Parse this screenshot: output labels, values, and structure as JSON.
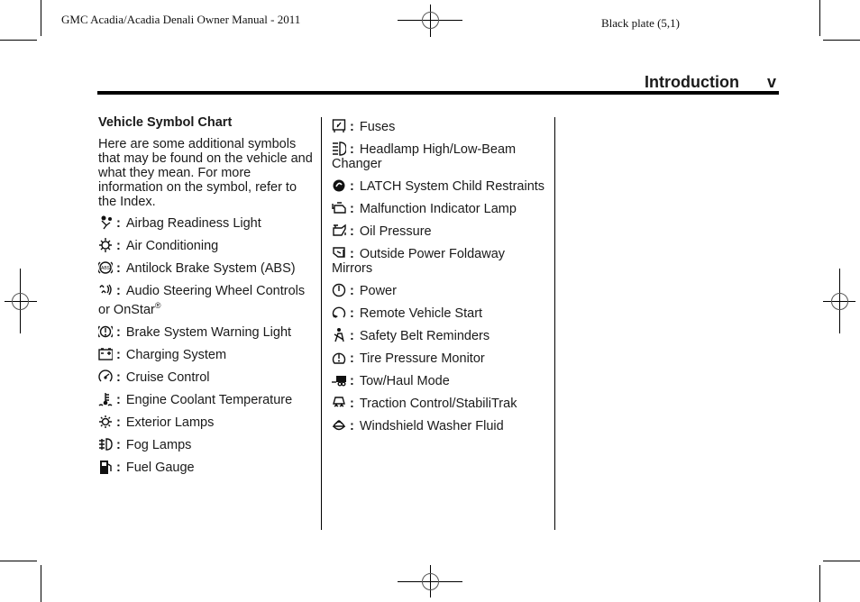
{
  "print_header": {
    "manual_title": "GMC Acadia/Acadia Denali Owner Manual - 2011",
    "plate": "Black plate (5,1)"
  },
  "running_head": {
    "section": "Introduction",
    "page_number": "v"
  },
  "section_title": "Vehicle Symbol Chart",
  "intro_text": "Here are some additional symbols that may be found on the vehicle and what they mean. For more information on the symbol, refer to the Index.",
  "separator": ":",
  "column1": [
    {
      "icon": "airbag-icon",
      "label": "Airbag Readiness Light"
    },
    {
      "icon": "air-conditioning-icon",
      "label": "Air Conditioning"
    },
    {
      "icon": "abs-icon",
      "label": "Antilock Brake System (ABS)"
    },
    {
      "icon": "audio-steering-icon",
      "label": "Audio Steering Wheel Controls or OnStar",
      "sup": "®"
    },
    {
      "icon": "brake-warning-icon",
      "label": "Brake System Warning Light"
    },
    {
      "icon": "battery-icon",
      "label": "Charging System"
    },
    {
      "icon": "cruise-control-icon",
      "label": "Cruise Control"
    },
    {
      "icon": "coolant-temp-icon",
      "label": "Engine Coolant Temperature"
    },
    {
      "icon": "exterior-lamp-icon",
      "label": "Exterior Lamps"
    },
    {
      "icon": "fog-lamp-icon",
      "label": "Fog Lamps"
    },
    {
      "icon": "fuel-pump-icon",
      "label": "Fuel Gauge"
    }
  ],
  "column2": [
    {
      "icon": "fuse-icon",
      "label": "Fuses"
    },
    {
      "icon": "headlamp-icon",
      "label": "Headlamp High/Low-Beam Changer"
    },
    {
      "icon": "latch-icon",
      "label": "LATCH System Child Restraints"
    },
    {
      "icon": "engine-icon",
      "label": "Malfunction Indicator Lamp"
    },
    {
      "icon": "oil-can-icon",
      "label": "Oil Pressure"
    },
    {
      "icon": "mirror-icon",
      "label": "Outside Power Foldaway Mirrors"
    },
    {
      "icon": "power-icon",
      "label": "Power"
    },
    {
      "icon": "remote-start-icon",
      "label": "Remote Vehicle Start"
    },
    {
      "icon": "seatbelt-icon",
      "label": "Safety Belt Reminders"
    },
    {
      "icon": "tire-pressure-icon",
      "label": "Tire Pressure Monitor"
    },
    {
      "icon": "trailer-icon",
      "label": "Tow/Haul Mode"
    },
    {
      "icon": "traction-icon",
      "label": "Traction Control/StabiliTrak"
    },
    {
      "icon": "washer-icon",
      "label": "Windshield Washer Fluid"
    }
  ]
}
